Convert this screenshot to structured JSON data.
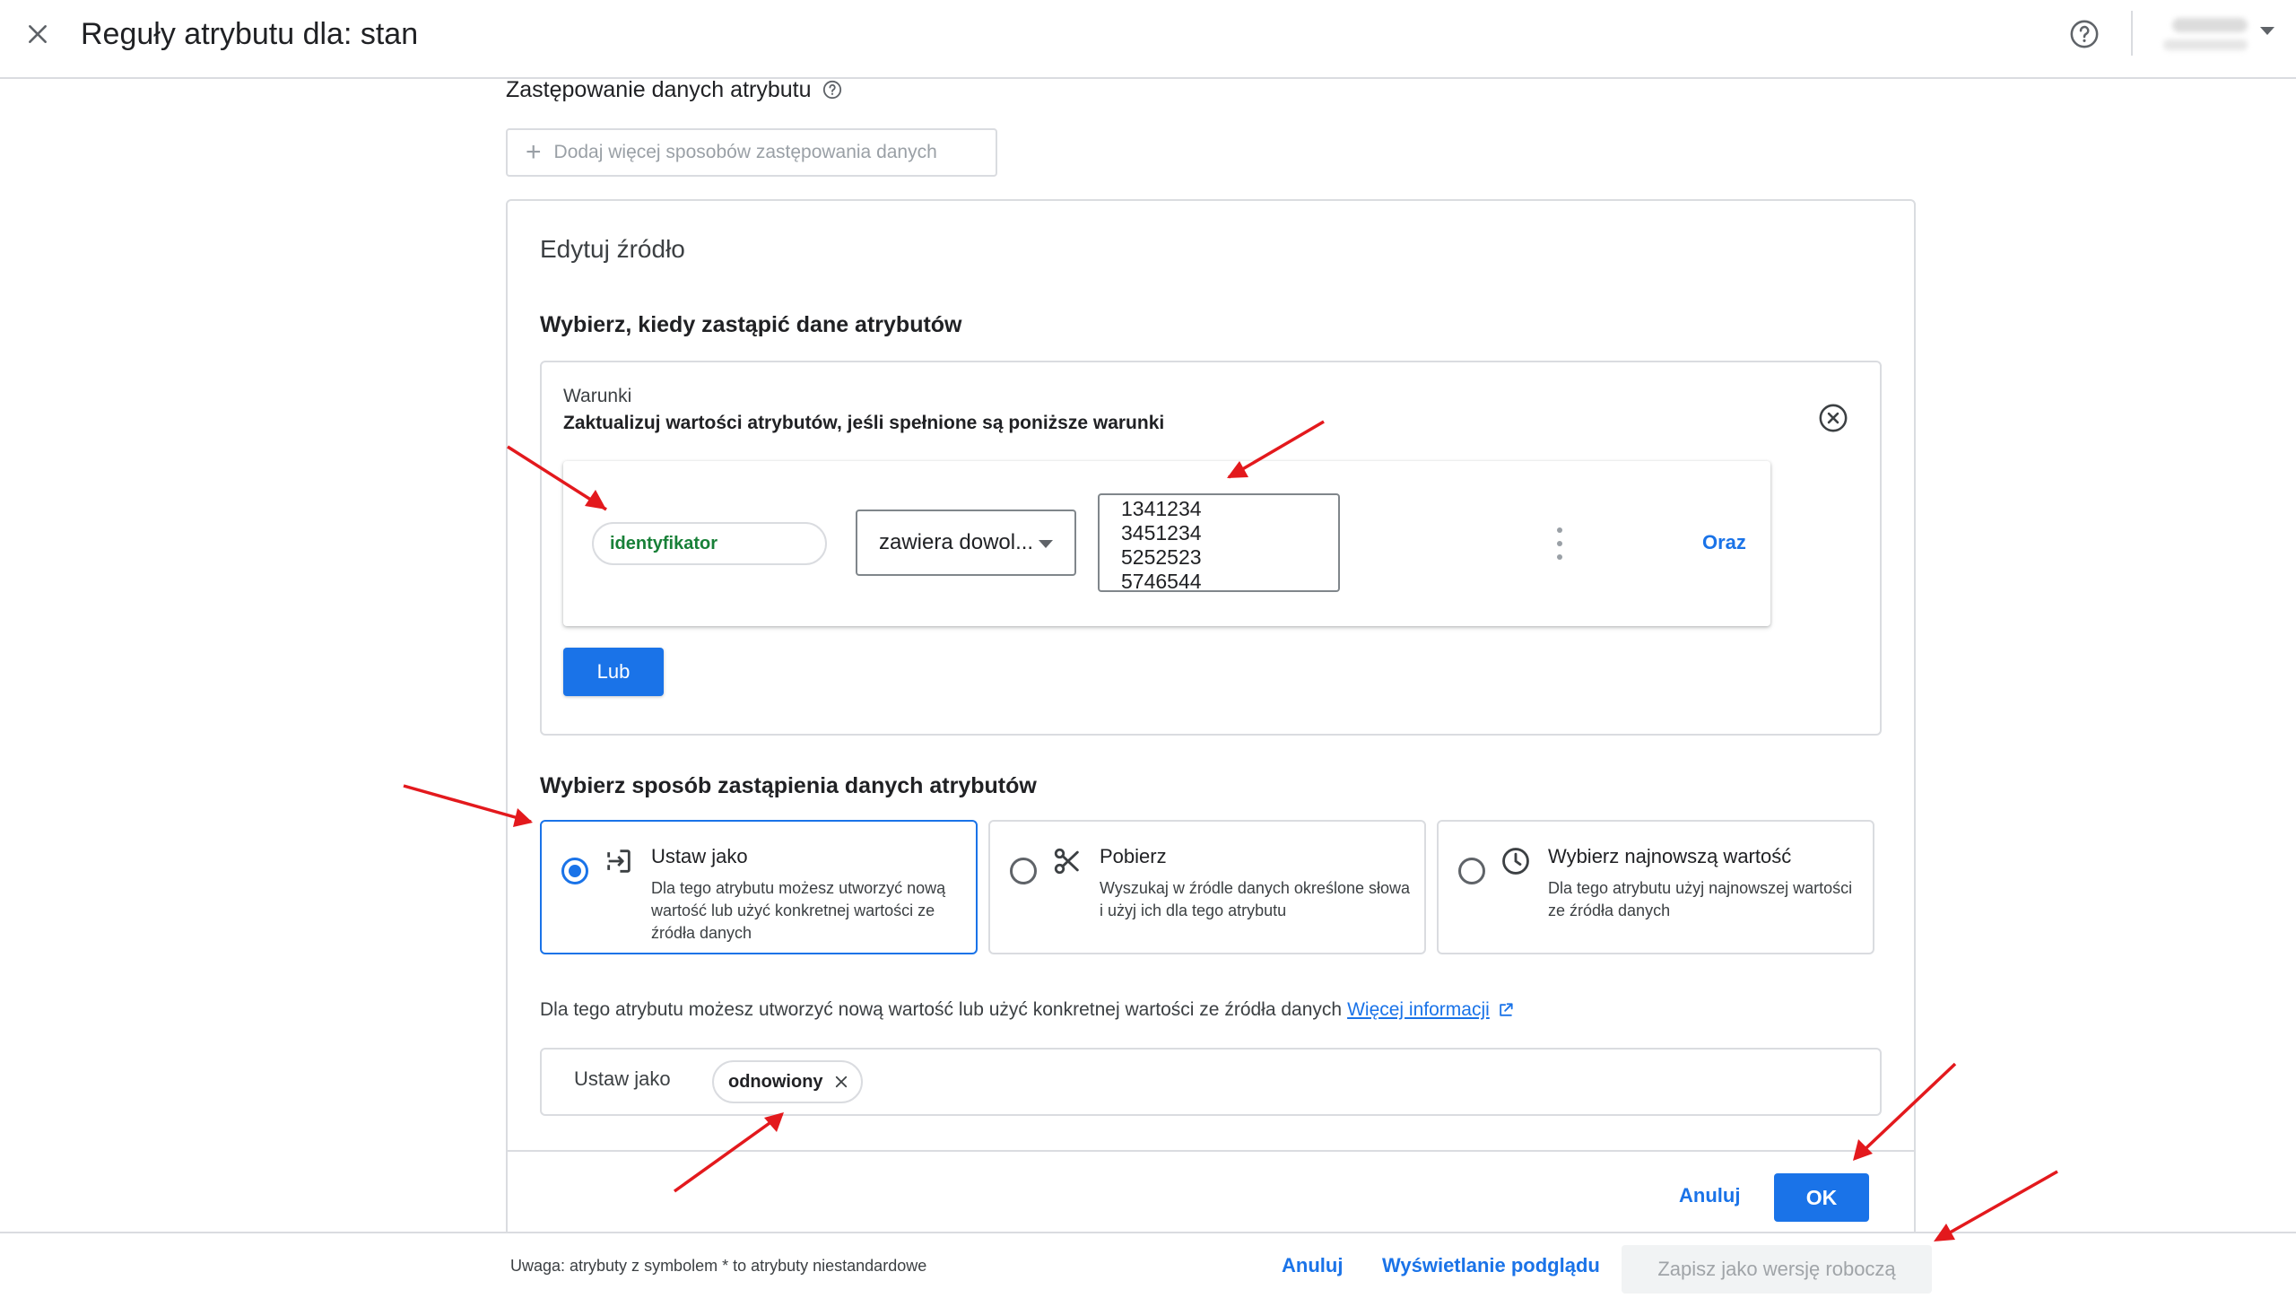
{
  "header": {
    "title": "Reguły atrybutu dla: stan"
  },
  "section": {
    "title": "Zastępowanie danych atrybutu",
    "add_more_label": "Dodaj więcej sposobów zastępowania danych"
  },
  "card": {
    "title": "Edytuj źródło",
    "when_label": "Wybierz, kiedy zastąpić dane atrybutów",
    "conditions": {
      "title": "Warunki",
      "description": "Zaktualizuj wartości atrybutów, jeśli spełnione są poniższe warunki",
      "rule": {
        "attribute": "identyfikator",
        "operator": "zawiera dowol...",
        "values": [
          "1341234",
          "3451234",
          "5252523",
          "5746544"
        ],
        "and_label": "Oraz"
      },
      "or_label": "Lub"
    },
    "how_label": "Wybierz sposób zastąpienia danych atrybutów",
    "options": [
      {
        "title": "Ustaw jako",
        "description": "Dla tego atrybutu możesz utworzyć nową wartość lub użyć konkretnej wartości ze źródła danych",
        "icon": "set-as-icon",
        "selected": true
      },
      {
        "title": "Pobierz",
        "description": "Wyszukaj w źródle danych określone słowa i użyj ich dla tego atrybutu",
        "icon": "scissors-icon",
        "selected": false
      },
      {
        "title": "Wybierz najnowszą wartość",
        "description": "Dla tego atrybutu użyj najnowszej wartości ze źródła danych",
        "icon": "clock-icon",
        "selected": false
      }
    ],
    "info_text": "Dla tego atrybutu możesz utworzyć nową wartość lub użyć konkretnej wartości ze źródła danych",
    "more_info_label": "Więcej informacji",
    "set_as": {
      "label": "Ustaw jako",
      "value": "odnowiony"
    },
    "cancel_label": "Anuluj",
    "ok_label": "OK"
  },
  "footer": {
    "note": "Uwaga: atrybuty z symbolem * to atrybuty niestandardowe",
    "cancel_label": "Anuluj",
    "preview_label": "Wyświetlanie podglądu",
    "save_draft_label": "Zapisz jako wersję roboczą"
  },
  "colors": {
    "accent": "#1a73e8",
    "attribute_green": "#188038",
    "annotation_red": "#e3191d"
  }
}
